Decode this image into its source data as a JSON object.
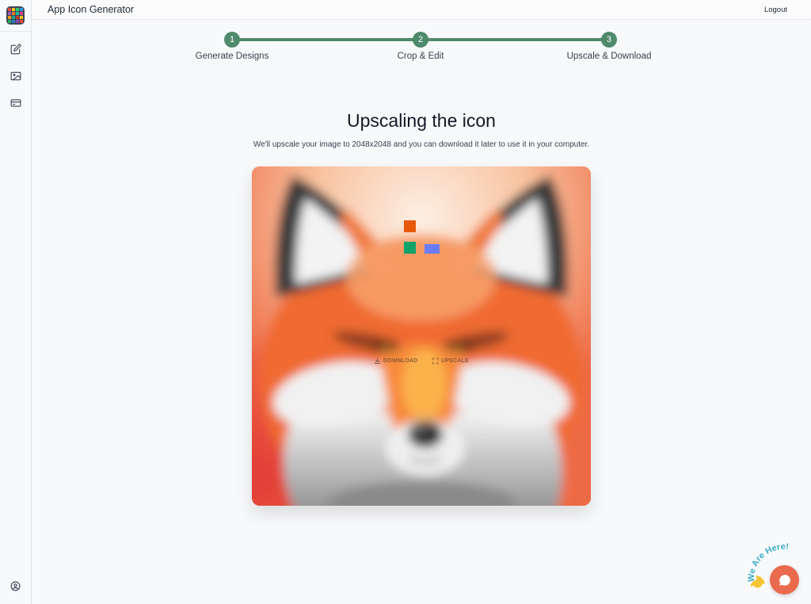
{
  "app": {
    "title": "App Icon Generator",
    "logo_icon": "app-logo-icon"
  },
  "header": {
    "logout_label": "Logout"
  },
  "sidebar": {
    "items": [
      {
        "icon": "edit-icon"
      },
      {
        "icon": "image-icon"
      },
      {
        "icon": "card-icon"
      }
    ],
    "footer_icon": "user-circle-icon"
  },
  "stepper": {
    "color": "#4e8a6b",
    "current_step": 3,
    "steps": [
      {
        "number": "1",
        "label": "Generate Designs"
      },
      {
        "number": "2",
        "label": "Crop & Edit"
      },
      {
        "number": "3",
        "label": "Upscale & Download"
      }
    ]
  },
  "main": {
    "heading": "Upscaling the icon",
    "subtext": "We'll upscale your image to 2048x2048 and you can download it later to use it in your computer."
  },
  "preview": {
    "image": "fox-icon-image",
    "loader_colors": [
      "#e8590c",
      "#12a36b",
      "#6b7cf5"
    ],
    "actions": [
      {
        "icon": "download-icon",
        "label": "DOWNLOAD"
      },
      {
        "icon": "expand-icon",
        "label": "UPSCALE"
      }
    ]
  },
  "chat": {
    "badge_text": "We Are Here!",
    "icon": "chat-bubble-icon",
    "color": "#ea6a4e",
    "badge_color": "#3aa8c8"
  }
}
